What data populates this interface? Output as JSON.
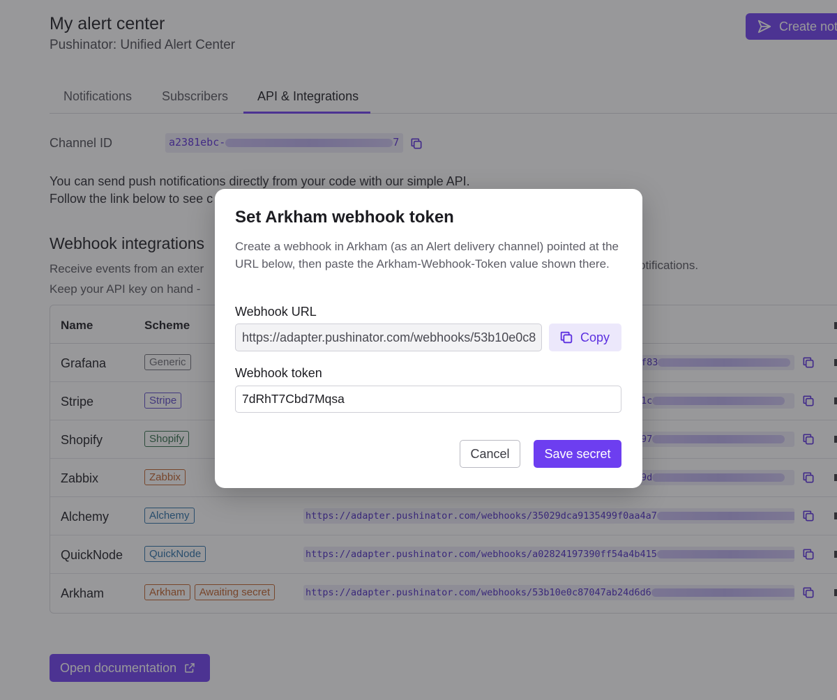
{
  "header": {
    "title": "My alert center",
    "subtitle": "Pushinator: Unified Alert Center",
    "create_button_label": "Create not"
  },
  "tabs": [
    {
      "label": "Notifications",
      "active": false
    },
    {
      "label": "Subscribers",
      "active": false
    },
    {
      "label": "API & Integrations",
      "active": true
    }
  ],
  "channel": {
    "label": "Channel ID",
    "value_visible": "a2381ebc-",
    "value_suffix": "7"
  },
  "intro": {
    "line1": "You can send push notifications directly from your code with our simple API.",
    "line2": "Follow the link below to see c"
  },
  "webhooks": {
    "title": "Webhook integrations",
    "desc_line1": "Receive events from an exter",
    "desc_line1_end": "otifications.",
    "desc_line2": "Keep your API key on hand - ",
    "columns": [
      "Name",
      "Scheme"
    ],
    "rows": [
      {
        "name": "Grafana",
        "badges": [
          {
            "text": "Generic",
            "color": "#6b6b73"
          }
        ],
        "url": "f83"
      },
      {
        "name": "Stripe",
        "badges": [
          {
            "text": "Stripe",
            "color": "#5b47c7"
          }
        ],
        "url": "1c"
      },
      {
        "name": "Shopify",
        "badges": [
          {
            "text": "Shopify",
            "color": "#2f6b47"
          }
        ],
        "url": "97"
      },
      {
        "name": "Zabbix",
        "badges": [
          {
            "text": "Zabbix",
            "color": "#c0602a"
          }
        ],
        "url": "9d"
      },
      {
        "name": "Alchemy",
        "badges": [
          {
            "text": "Alchemy",
            "color": "#2a6fa8"
          }
        ],
        "url": "https://adapter.pushinator.com/webhooks/35029dca9135499f0aa4a7"
      },
      {
        "name": "QuickNode",
        "badges": [
          {
            "text": "QuickNode",
            "color": "#2a6fa8"
          }
        ],
        "url": "https://adapter.pushinator.com/webhooks/a02824197390ff54a4b415"
      },
      {
        "name": "Arkham",
        "badges": [
          {
            "text": "Arkham",
            "color": "#c0602a"
          },
          {
            "text": "Awaiting secret",
            "color": "#c0602a"
          }
        ],
        "url": "https://adapter.pushinator.com/webhooks/53b10e0c87047ab24d6d6"
      }
    ]
  },
  "doc_button_label": "Open documentation",
  "modal": {
    "title": "Set Arkham webhook token",
    "description": "Create a webhook in Arkham (as an Alert delivery channel) pointed at the URL below, then paste the Arkham-Webhook-Token value shown there.",
    "url_label": "Webhook URL",
    "url_value": "https://adapter.pushinator.com/webhooks/53b10e0c8",
    "copy_label": "Copy",
    "token_label": "Webhook token",
    "token_value": "7dRhT7Cbd7Mqsa",
    "cancel_label": "Cancel",
    "save_label": "Save secret"
  },
  "colors": {
    "accent": "#6d3ef0",
    "overlay": "rgba(40,40,44,0.48)"
  }
}
